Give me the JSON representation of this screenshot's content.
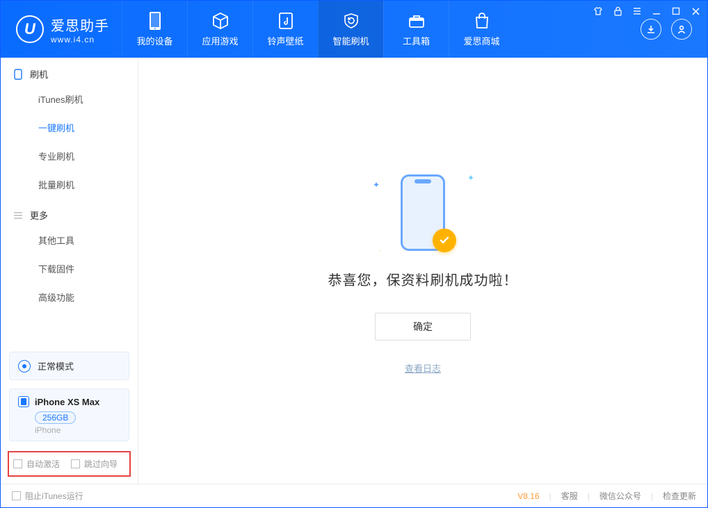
{
  "logo": {
    "name": "爱思助手",
    "url": "www.i4.cn",
    "glyph": "U"
  },
  "nav": [
    {
      "label": "我的设备"
    },
    {
      "label": "应用游戏"
    },
    {
      "label": "铃声壁纸"
    },
    {
      "label": "智能刷机"
    },
    {
      "label": "工具箱"
    },
    {
      "label": "爱思商城"
    }
  ],
  "sidebar": {
    "group1": "刷机",
    "items1": [
      "iTunes刷机",
      "一键刷机",
      "专业刷机",
      "批量刷机"
    ],
    "group2": "更多",
    "items2": [
      "其他工具",
      "下载固件",
      "高级功能"
    ]
  },
  "mode": {
    "label": "正常模式"
  },
  "device": {
    "name": "iPhone XS Max",
    "storage": "256GB",
    "type": "iPhone"
  },
  "options": {
    "auto_activate": "自动激活",
    "skip_guide": "跳过向导"
  },
  "main": {
    "success": "恭喜您，保资料刷机成功啦！",
    "ok": "确定",
    "view_log": "查看日志"
  },
  "footer": {
    "stop_itunes": "阻止iTunes运行",
    "version": "V8.16",
    "support": "客服",
    "wechat": "微信公众号",
    "update": "检查更新"
  }
}
